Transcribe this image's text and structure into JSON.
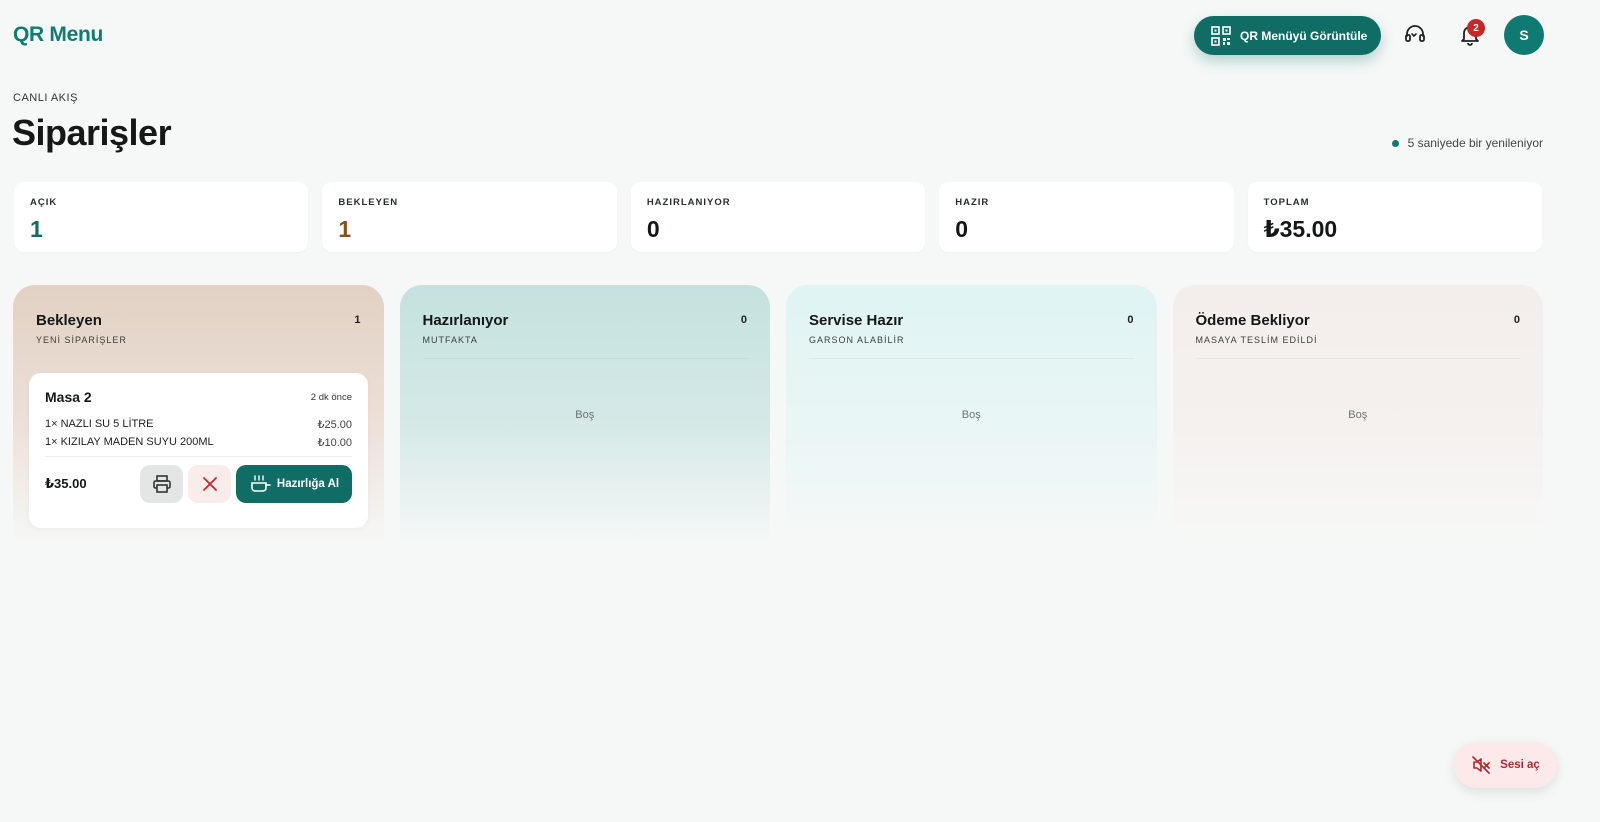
{
  "app": {
    "logo": "QR Menu"
  },
  "header": {
    "qr_button_label": "QR Menüyü Görüntüle",
    "notification_count": "2",
    "avatar_initial": "S"
  },
  "page": {
    "eyebrow": "CANLI AKIŞ",
    "title": "Siparişler",
    "refresh_text": "5 saniyede bir yenileniyor"
  },
  "stats": [
    {
      "label": "AÇIK",
      "value": "1",
      "color": "#0f6d65"
    },
    {
      "label": "BEKLEYEN",
      "value": "1",
      "color": "#8a4f1e"
    },
    {
      "label": "HAZIRLANIYOR",
      "value": "0"
    },
    {
      "label": "HAZIR",
      "value": "0"
    },
    {
      "label": "TOPLAM",
      "value": "₺35.00"
    }
  ],
  "columns": [
    {
      "title": "Bekleyen",
      "subtitle": "YENİ SİPARİŞLER",
      "count": "1"
    },
    {
      "title": "Hazırlanıyor",
      "subtitle": "MUTFAKTA",
      "count": "0",
      "empty": "Boş"
    },
    {
      "title": "Servise Hazır",
      "subtitle": "GARSON ALABİLİR",
      "count": "0",
      "empty": "Boş"
    },
    {
      "title": "Ödeme Bekliyor",
      "subtitle": "MASAYA TESLİM EDİLDİ",
      "count": "0",
      "empty": "Boş"
    }
  ],
  "order": {
    "table": "Masa 2",
    "time": "2 dk önce",
    "items": [
      {
        "text": "1× NAZLI SU 5 LİTRE",
        "price": "₺25.00"
      },
      {
        "text": "1× KIZILAY MADEN SUYU 200ML",
        "price": "₺10.00"
      }
    ],
    "total": "₺35.00",
    "prepare_label": "Hazırlığa Al"
  },
  "sound": {
    "label": "Sesi aç"
  },
  "colors": {
    "primary": "#0f6d65",
    "danger": "#c62828"
  }
}
